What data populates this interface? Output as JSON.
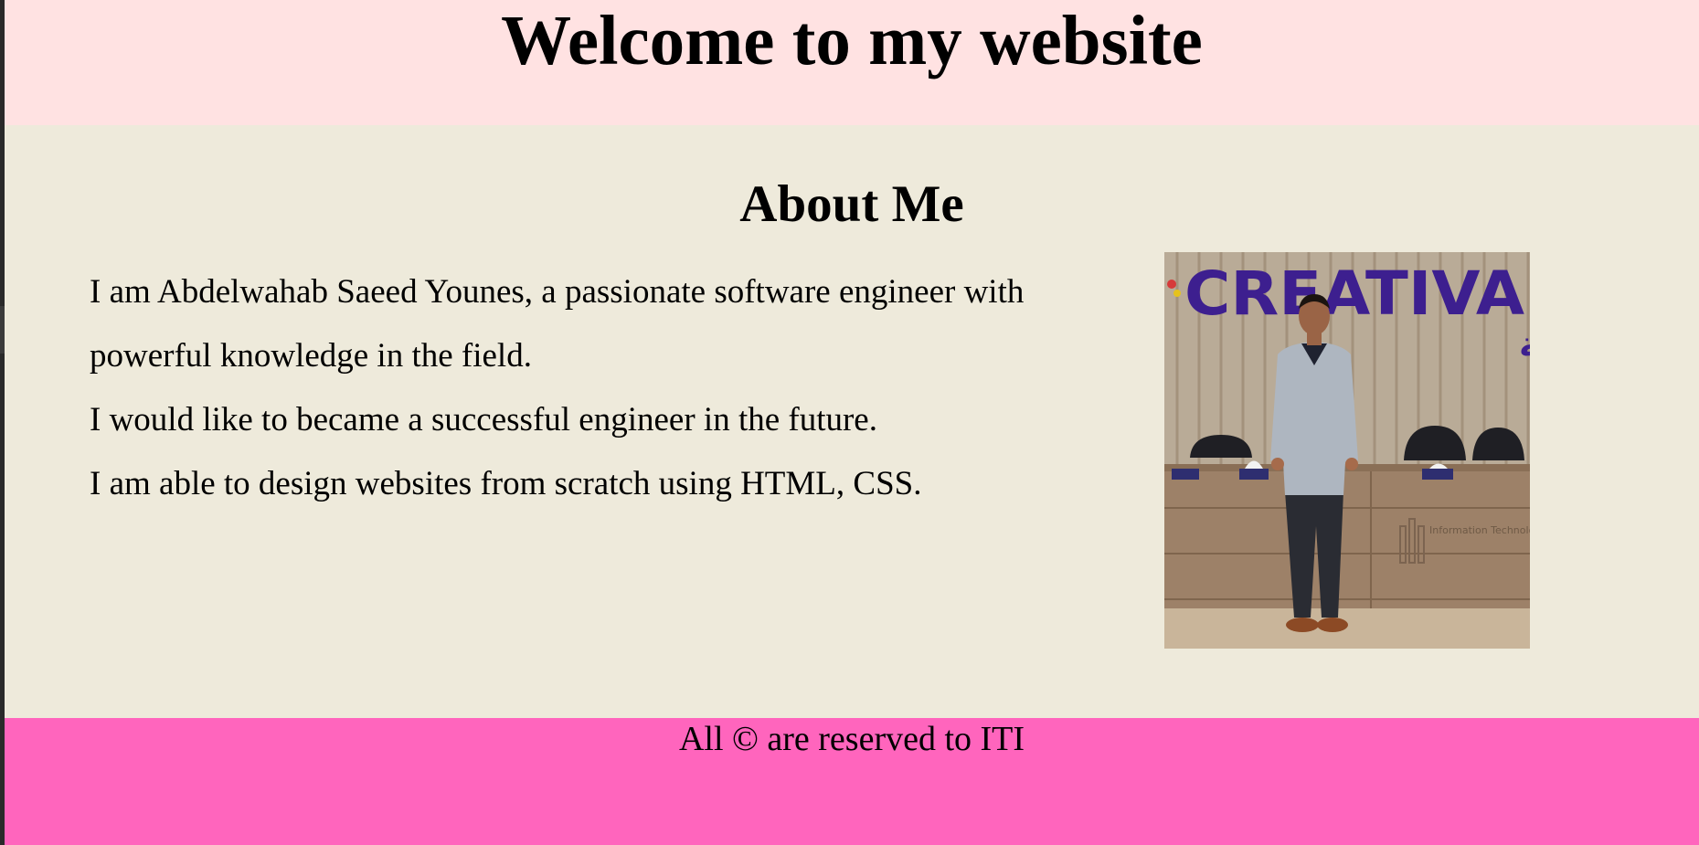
{
  "header": {
    "title": "Welcome to my website"
  },
  "about": {
    "heading": "About Me",
    "lines": [
      "I am Abdelwahab Saeed Younes, a passionate software engineer with powerful knowledge in the field.",
      "I would like to became a successful engineer in the future.",
      "I am able to design websites from scratch using HTML, CSS."
    ],
    "photo": {
      "sign_text": "CREATIVA",
      "sign_subtext": "مراكز إبداع مصر الرقمية",
      "logo_text": "Information Technology Institute"
    }
  },
  "footer": {
    "text": "All © are reserved to ITI"
  },
  "colors": {
    "header_bg": "#ffe2e2",
    "main_bg": "#eeeadb",
    "footer_bg": "#ff65bd"
  }
}
